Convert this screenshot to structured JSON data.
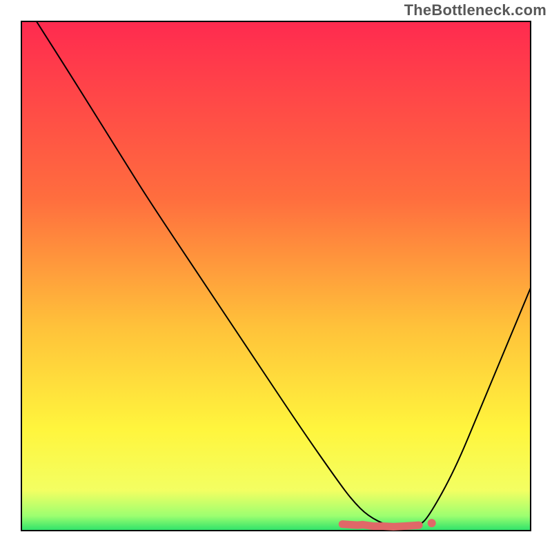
{
  "watermark": "TheBottleneck.com",
  "chart_data": {
    "type": "line",
    "title": "",
    "xlabel": "",
    "ylabel": "",
    "xlim": [
      0,
      100
    ],
    "ylim": [
      0,
      100
    ],
    "grid": false,
    "legend": false,
    "background_gradient_stops": [
      {
        "offset": 0,
        "color": "#ff2a4f"
      },
      {
        "offset": 35,
        "color": "#ff6e3e"
      },
      {
        "offset": 60,
        "color": "#ffc23a"
      },
      {
        "offset": 80,
        "color": "#fff53d"
      },
      {
        "offset": 92,
        "color": "#f3ff62"
      },
      {
        "offset": 97,
        "color": "#9cff70"
      },
      {
        "offset": 100,
        "color": "#27e06a"
      }
    ],
    "series": [
      {
        "name": "bottleneck-curve",
        "stroke": "#000000",
        "stroke_width": 2,
        "x": [
          3,
          10,
          20,
          25,
          35,
          45,
          55,
          62,
          65,
          68,
          72,
          75,
          78,
          80,
          85,
          90,
          95,
          100
        ],
        "y": [
          100,
          89,
          73,
          65,
          50,
          35,
          20,
          10,
          6,
          3,
          1,
          0.5,
          1,
          3,
          12,
          24,
          36,
          48
        ]
      },
      {
        "name": "minimum-markers",
        "type": "scatter",
        "stroke": "#e06868",
        "fill": "#e06868",
        "marker_radius": 4,
        "x": [
          63,
          66,
          67,
          69,
          71,
          73,
          75,
          78,
          80.5
        ],
        "y": [
          1.4,
          1.2,
          1.3,
          1.0,
          1.0,
          0.9,
          1.0,
          1.2,
          1.6
        ]
      }
    ]
  }
}
